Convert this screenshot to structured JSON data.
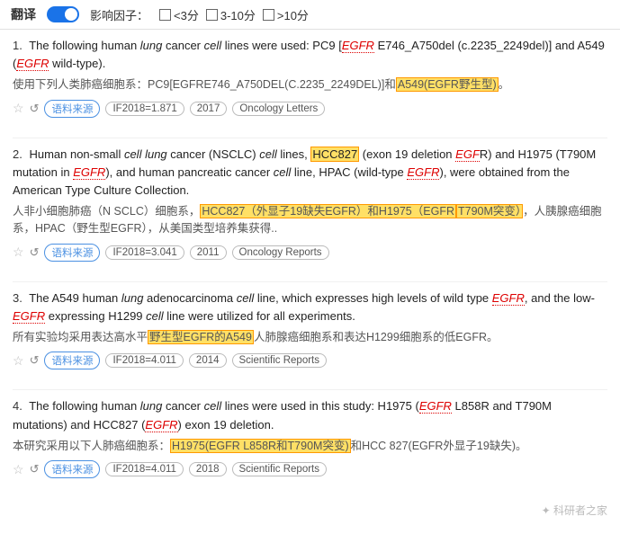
{
  "header": {
    "translate_label": "翻译",
    "impact_label": "影响因子：",
    "filters": [
      {
        "id": "lt3",
        "label": "<3分"
      },
      {
        "id": "3to10",
        "label": "3-10分"
      },
      {
        "id": "gt10",
        "label": ">10分"
      }
    ]
  },
  "results": [
    {
      "number": "1.",
      "text_en_parts": [
        "The following human ",
        "lung",
        " cancer ",
        "cell",
        " lines were used: PC9 [",
        "EGFR",
        " E746_A750del (c.2235_2249del)] and A549 (",
        "EGFR",
        " wild-type)."
      ],
      "text_zh": "使用下列人类肺癌细胞系：PC9[EGFRE746_A750DEL(C.2235_2249DEL)]和",
      "text_zh_highlight": "A549(EGFR野生型)",
      "text_zh_end": "。",
      "meta_if": "IF2018=1.871",
      "meta_year": "2017",
      "meta_journal": "Oncology Letters"
    },
    {
      "number": "2.",
      "text_en_parts": [
        "Human non-small ",
        "cell lung",
        " cancer (NSCLC) ",
        "cell",
        " lines, ",
        "HCC827",
        " (exon 19 deletion ",
        "EGF",
        "R",
        ") and H1975 (T790M mutation in ",
        "EGFR",
        "), and human pancreatic cancer ",
        "cell",
        " line, HPAC (wild-type ",
        "EGFR",
        "), were obtained from the American Type Culture Collection."
      ],
      "text_zh": "人非小细胞肺癌（N SCLC）细胞系，",
      "text_zh_highlight": "HCC827（外显子19缺失EGFR）和H1975（EGFR",
      "text_zh_highlight2": "T790M突变）",
      "text_zh_end": "，人胰腺癌细胞系，HPAC（野生型EGFR），从美国类型培养集获得..",
      "meta_if": "IF2018=3.041",
      "meta_year": "2011",
      "meta_journal": "Oncology Reports"
    },
    {
      "number": "3.",
      "text_en_parts": [
        "The A549 human ",
        "lung",
        " adenocarcinoma ",
        "cell",
        " line, which expresses high levels of wild type ",
        "EGFR",
        ", and the low-",
        "EGFR",
        " expressing H1299 ",
        "cell",
        " line were utilized for all experiments."
      ],
      "text_zh": "所有实验均采用表达高水平",
      "text_zh_highlight": "野生型EGFR的A549",
      "text_zh_end": "人肺腺癌细胞系和表达H1299细胞系的低EGFR。",
      "meta_if": "IF2018=4.011",
      "meta_year": "2014",
      "meta_journal": "Scientific Reports"
    },
    {
      "number": "4.",
      "text_en_parts": [
        "The following human ",
        "lung",
        " cancer ",
        "cell",
        " lines were used in this study: H1975 (",
        "EGFR",
        " L858R and T790M mutations) and HCC827 (",
        "EGFR",
        ") exon 19 deletion."
      ],
      "text_zh": "本研究采用以下人肺癌细胞系：",
      "text_zh_highlight": "H1975(EGFR L858R和T790M突变)",
      "text_zh_end": "和HCC 827(EGFR外显子19缺失)。",
      "meta_if": "IF2018=4.011",
      "meta_year": "2018",
      "meta_journal": "Scientific Reports"
    }
  ],
  "watermark": "科研者之家",
  "labels": {
    "source": "语料来源"
  }
}
